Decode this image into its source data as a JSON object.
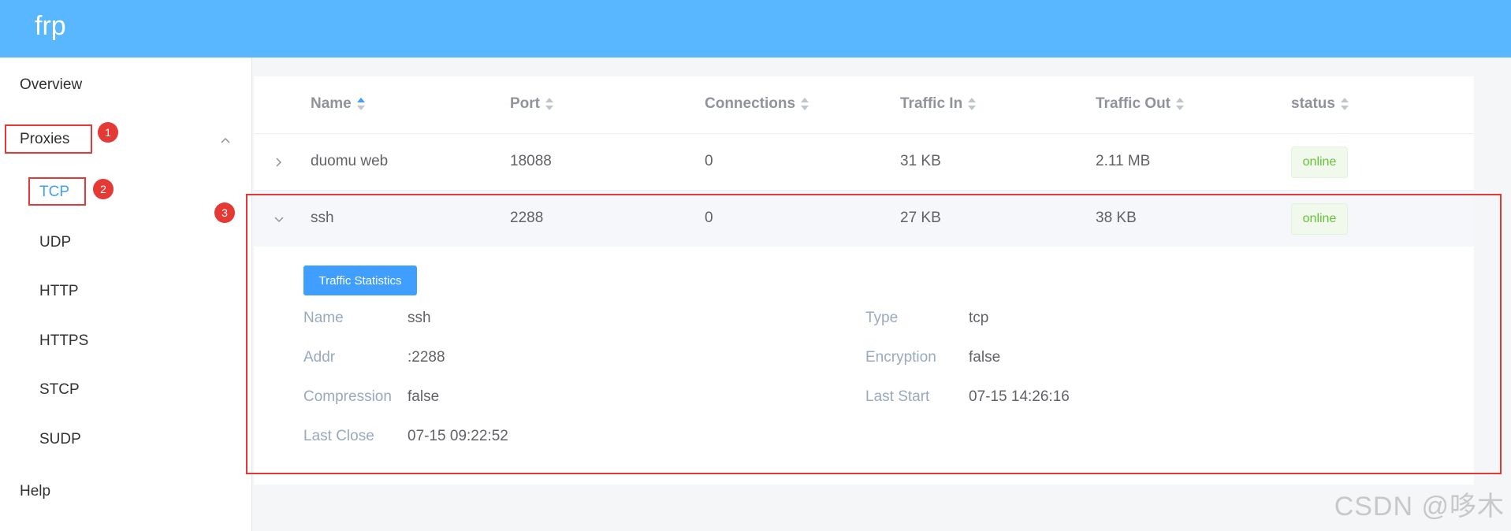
{
  "app": {
    "title": "frp"
  },
  "sidebar": {
    "overview": "Overview",
    "proxies": "Proxies",
    "items": [
      {
        "label": "TCP",
        "active": true
      },
      {
        "label": "UDP"
      },
      {
        "label": "HTTP"
      },
      {
        "label": "HTTPS"
      },
      {
        "label": "STCP"
      },
      {
        "label": "SUDP"
      }
    ],
    "help": "Help"
  },
  "table": {
    "columns": [
      "Name",
      "Port",
      "Connections",
      "Traffic In",
      "Traffic Out",
      "status"
    ],
    "sorted_column": "Name",
    "rows": [
      {
        "name": "duomu web",
        "port": "18088",
        "connections": "0",
        "traffic_in": "31 KB",
        "traffic_out": "2.11 MB",
        "status": "online",
        "expanded": false
      },
      {
        "name": "ssh",
        "port": "2288",
        "connections": "0",
        "traffic_in": "27 KB",
        "traffic_out": "38 KB",
        "status": "online",
        "expanded": true
      }
    ]
  },
  "detail": {
    "button": "Traffic Statistics",
    "left": [
      {
        "label": "Name",
        "value": "ssh"
      },
      {
        "label": "Addr",
        "value": ":2288"
      },
      {
        "label": "Compression",
        "value": "false"
      },
      {
        "label": "Last Close",
        "value": "07-15 09:22:52"
      }
    ],
    "right": [
      {
        "label": "Type",
        "value": "tcp"
      },
      {
        "label": "Encryption",
        "value": "false"
      },
      {
        "label": "Last Start",
        "value": "07-15 14:26:16"
      }
    ]
  },
  "annotations": [
    "1",
    "2",
    "3"
  ],
  "watermark": "CSDN @哆木",
  "colors": {
    "header": "#58b7ff",
    "accent": "#409eff",
    "online": "#67c23a",
    "annotation": "#e53935"
  }
}
